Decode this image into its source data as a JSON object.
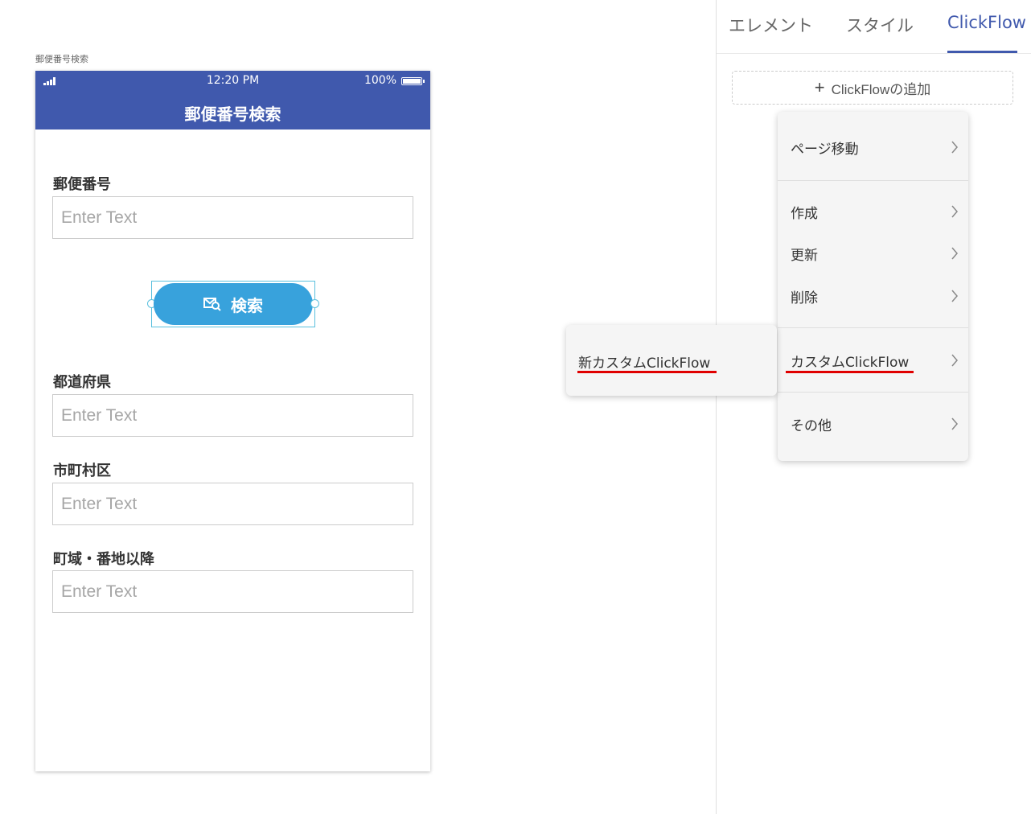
{
  "page": {
    "label": "郵便番号検索"
  },
  "status_bar": {
    "time": "12:20 PM",
    "battery": "100%"
  },
  "screen": {
    "title": "郵便番号検索",
    "fields": [
      {
        "label": "郵便番号",
        "placeholder": "Enter Text"
      },
      {
        "label": "都道府県",
        "placeholder": "Enter Text"
      },
      {
        "label": "市町村区",
        "placeholder": "Enter Text"
      },
      {
        "label": "町域・番地以降",
        "placeholder": "Enter Text"
      }
    ],
    "search_button": {
      "label": "検索",
      "icon": "search-mail-icon"
    }
  },
  "panel": {
    "tabs": [
      {
        "label": "エレメント",
        "active": false
      },
      {
        "label": "スタイル",
        "active": false
      },
      {
        "label": "ClickFlow",
        "active": true
      }
    ],
    "add_button": {
      "label": "ClickFlowの追加",
      "icon": "plus-icon"
    }
  },
  "menu": {
    "items": [
      {
        "label": "ページ移動"
      },
      {
        "label": "作成"
      },
      {
        "label": "更新"
      },
      {
        "label": "削除"
      },
      {
        "label": "カスタムClickFlow"
      },
      {
        "label": "その他"
      }
    ]
  },
  "submenu": {
    "items": [
      {
        "label": "新カスタムClickFlow"
      }
    ]
  },
  "colors": {
    "header": "#4059ad",
    "button": "#38a2dc",
    "highlight": "#e00000",
    "accent": "#4059ad"
  }
}
